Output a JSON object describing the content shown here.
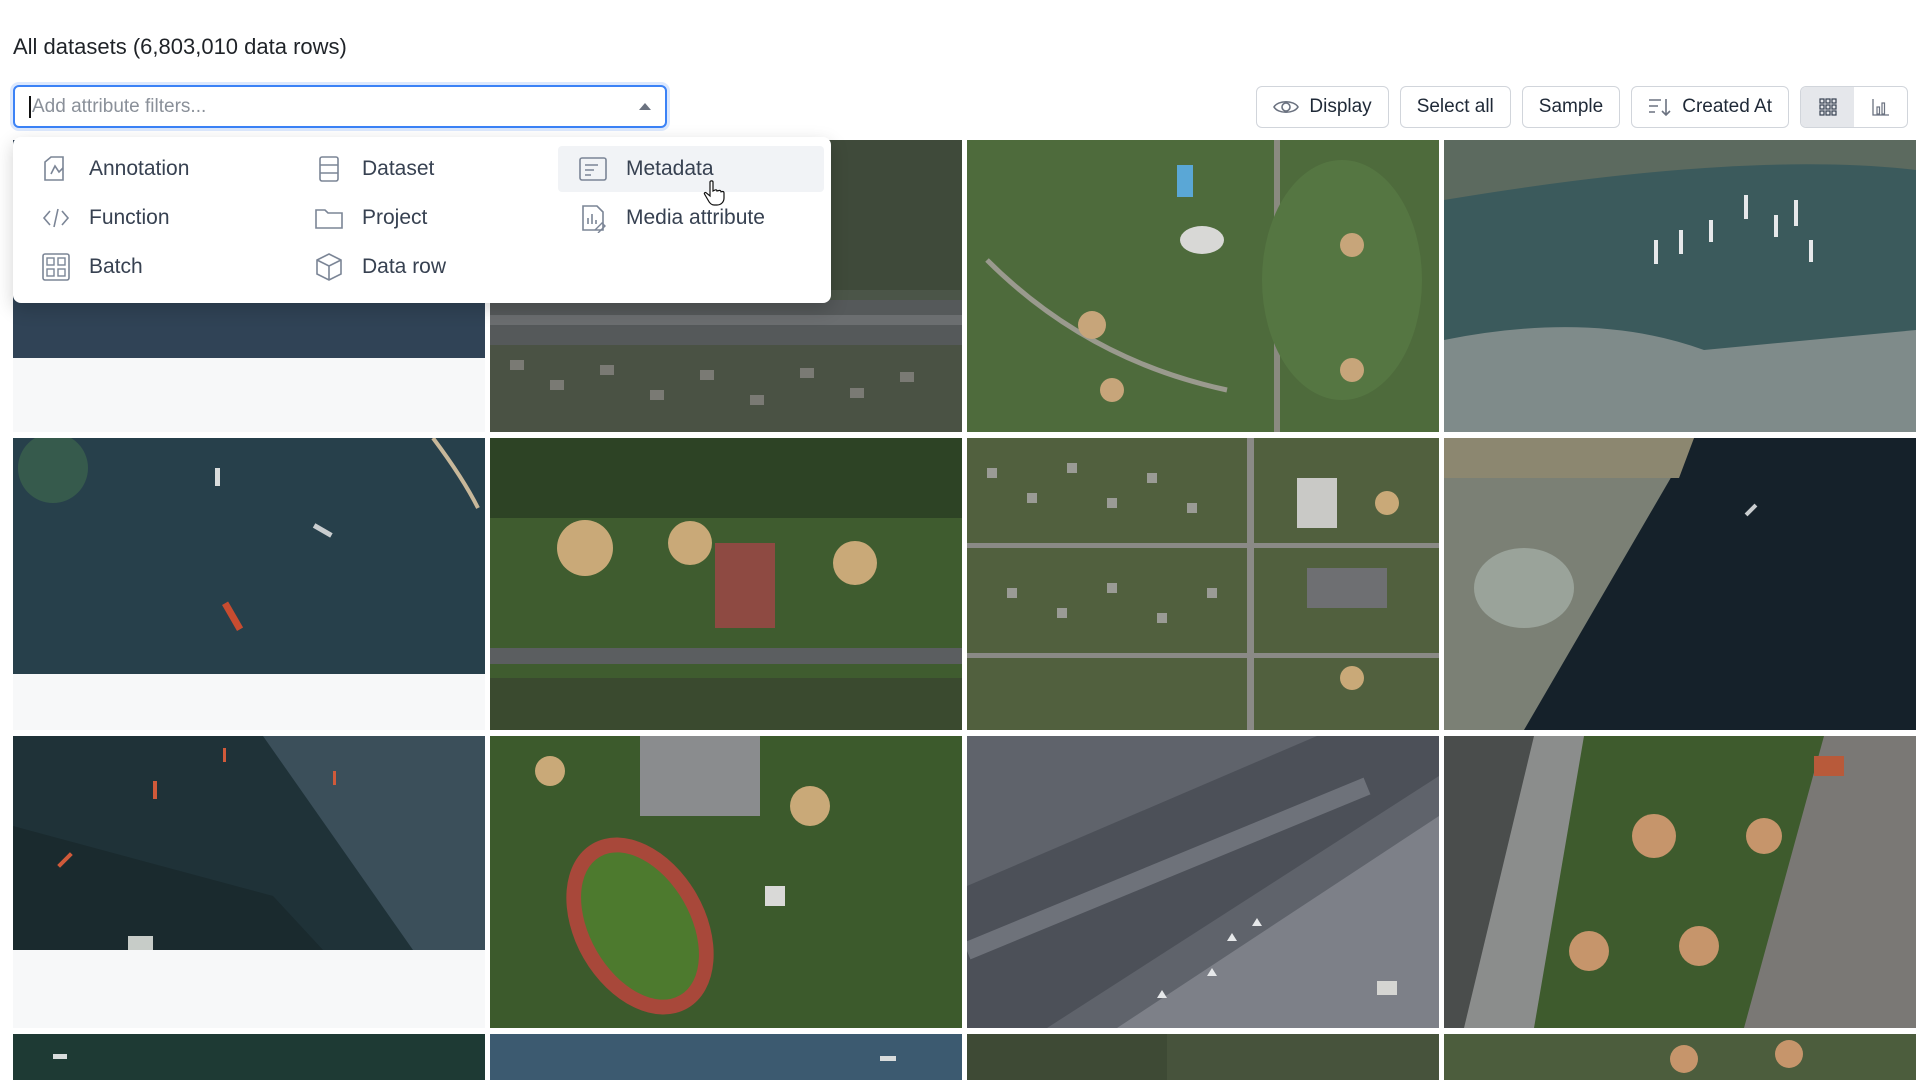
{
  "header": {
    "title": "All datasets (6,803,010 data rows)"
  },
  "filter": {
    "placeholder": "Add attribute filters..."
  },
  "toolbar": {
    "display_label": "Display",
    "select_all_label": "Select all",
    "sample_label": "Sample",
    "sort_label": "Created At"
  },
  "menu": {
    "items": [
      {
        "label": "Annotation",
        "icon": "annotation-icon"
      },
      {
        "label": "Dataset",
        "icon": "dataset-icon"
      },
      {
        "label": "Metadata",
        "icon": "metadata-icon",
        "hovered": true
      },
      {
        "label": "Function",
        "icon": "function-icon"
      },
      {
        "label": "Project",
        "icon": "project-icon"
      },
      {
        "label": "Media attribute",
        "icon": "media-attribute-icon"
      },
      {
        "label": "Batch",
        "icon": "batch-icon"
      },
      {
        "label": "Data row",
        "icon": "data-row-icon"
      }
    ]
  },
  "colors": {
    "accent": "#3b82f6"
  }
}
